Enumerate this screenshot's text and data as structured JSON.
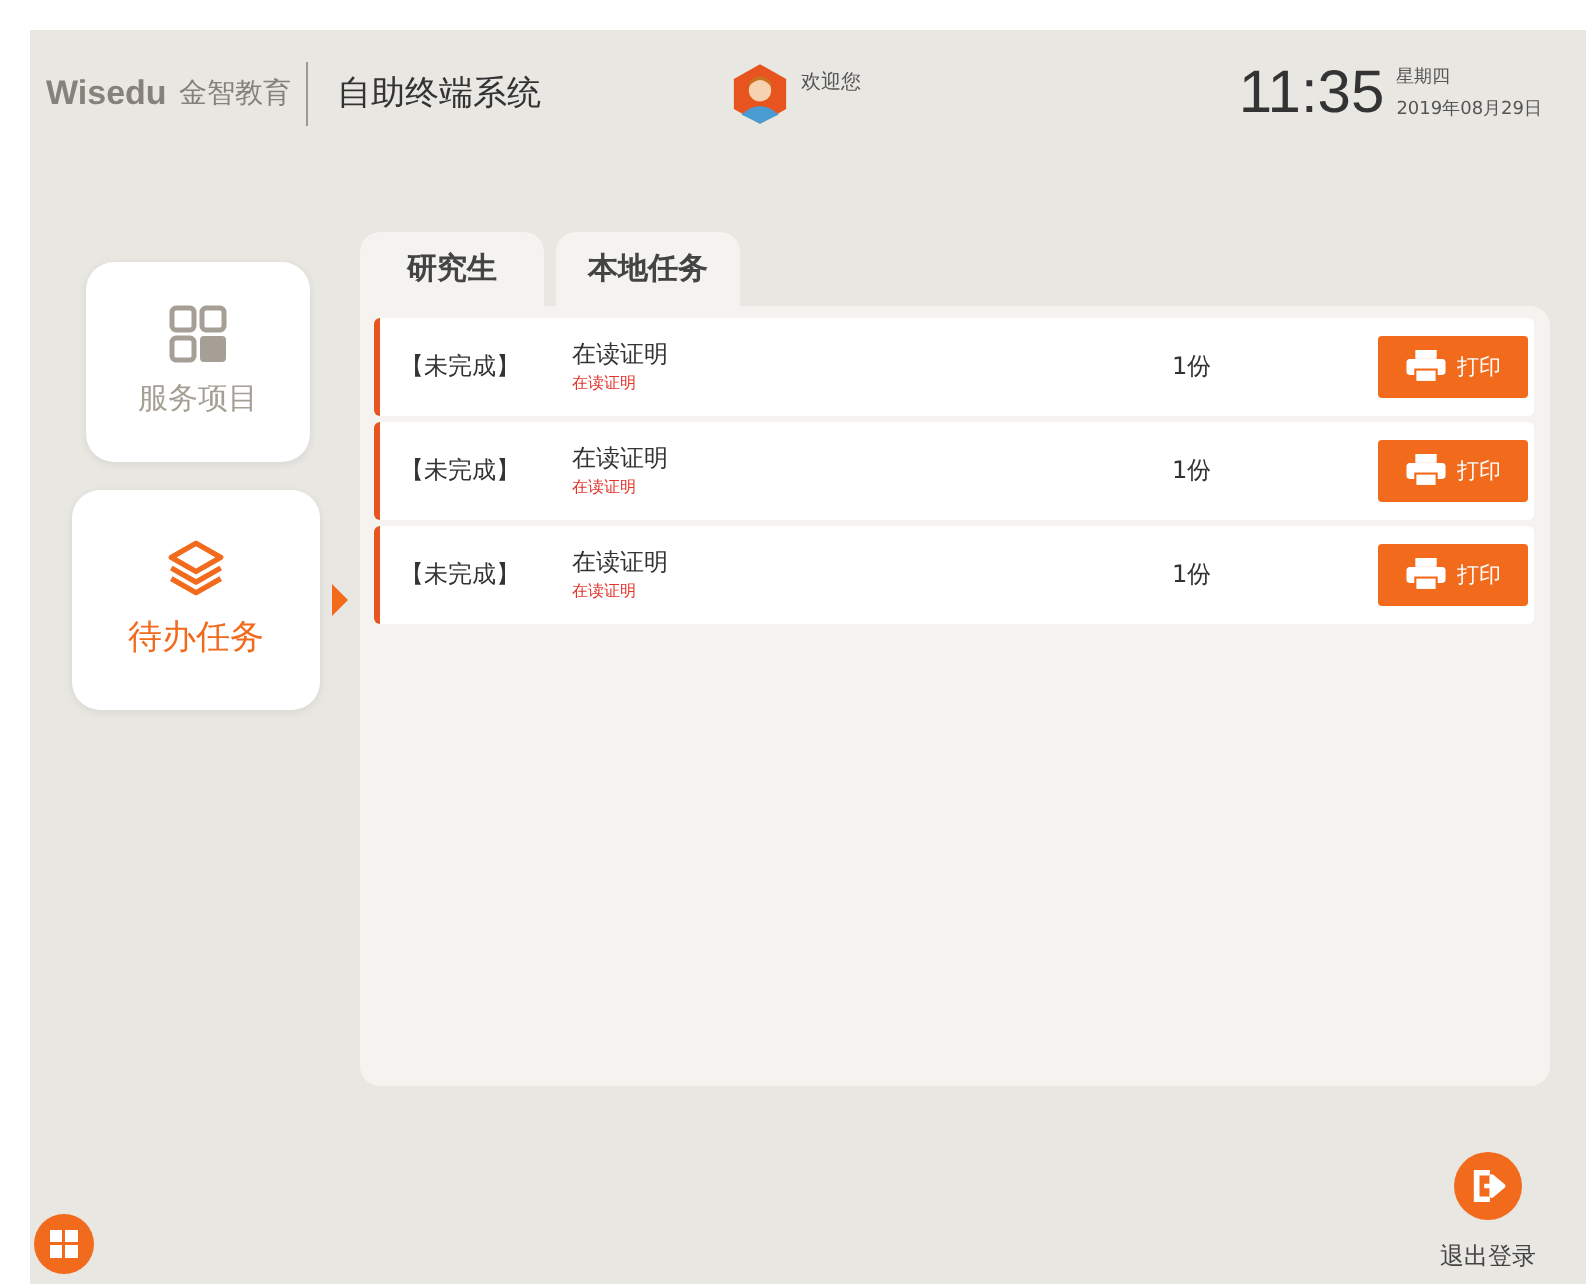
{
  "header": {
    "brand": "Wisedu",
    "brand_cn": "金智教育",
    "system_title": "自助终端系统",
    "welcome": "欢迎您",
    "time": "11:35",
    "weekday": "星期四",
    "date": "2019年08月29日"
  },
  "sidebar": {
    "items": [
      {
        "label": "服务项目",
        "kind": "grid",
        "selected": false
      },
      {
        "label": "待办任务",
        "kind": "layers",
        "selected": true
      }
    ]
  },
  "tabs": [
    {
      "label": "研究生"
    },
    {
      "label": "本地任务"
    }
  ],
  "tasks": [
    {
      "status": "【未完成】",
      "title": "在读证明",
      "subtitle": "在读证明",
      "copies": "1份",
      "action": "打印"
    },
    {
      "status": "【未完成】",
      "title": "在读证明",
      "subtitle": "在读证明",
      "copies": "1份",
      "action": "打印"
    },
    {
      "status": "【未完成】",
      "title": "在读证明",
      "subtitle": "在读证明",
      "copies": "1份",
      "action": "打印"
    }
  ],
  "logout": {
    "label": "退出登录"
  }
}
